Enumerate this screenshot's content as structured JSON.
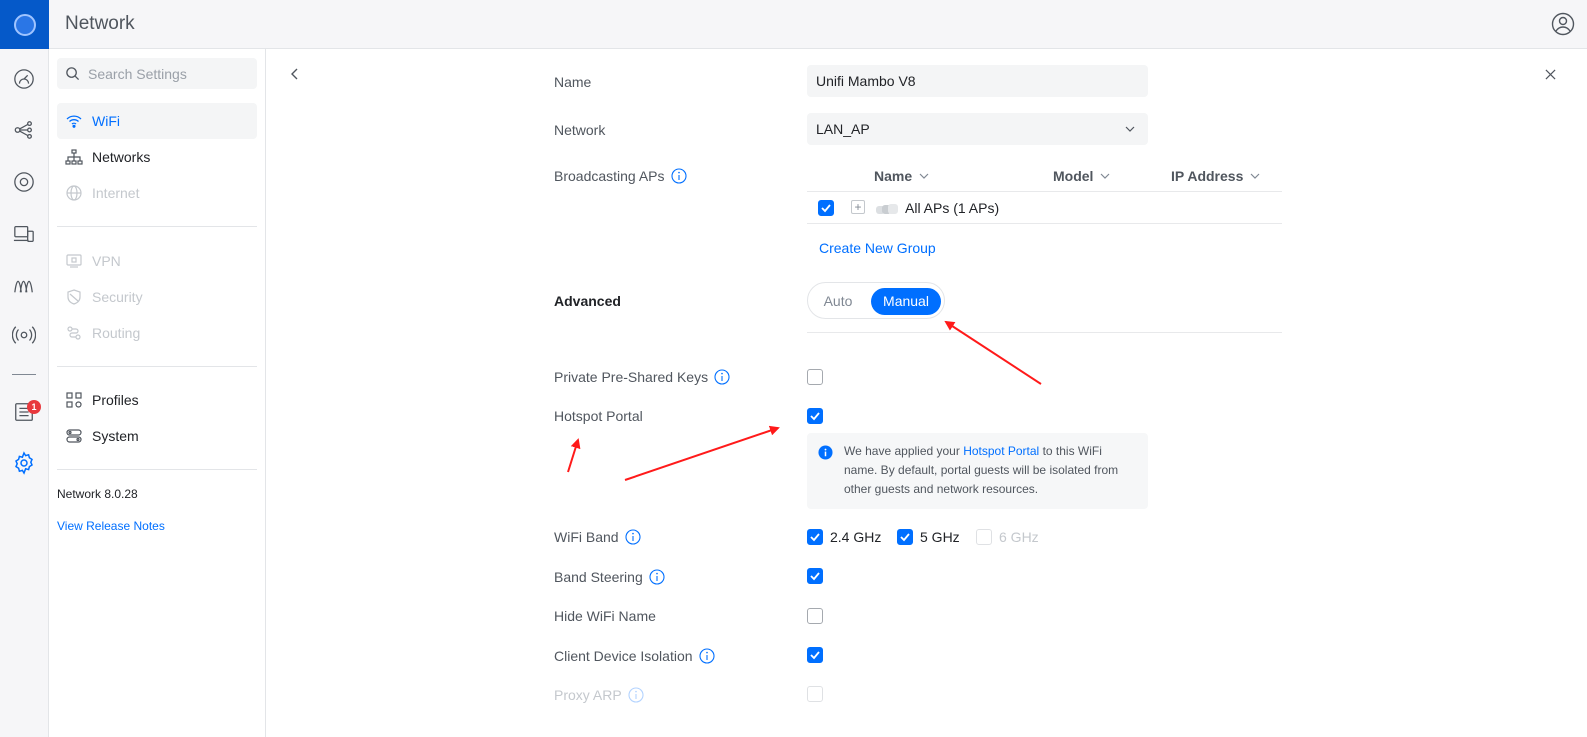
{
  "app": {
    "title": "Network"
  },
  "search": {
    "placeholder": "Search Settings"
  },
  "sidebar": {
    "items": [
      {
        "label": "WiFi",
        "state": "active",
        "icon": "wifi-icon"
      },
      {
        "label": "Networks",
        "state": "normal",
        "icon": "network-topology-icon"
      },
      {
        "label": "Internet",
        "state": "disabled",
        "icon": "globe-icon"
      },
      {
        "label": "VPN",
        "state": "disabled",
        "icon": "vpn-icon"
      },
      {
        "label": "Security",
        "state": "disabled",
        "icon": "shield-icon"
      },
      {
        "label": "Routing",
        "state": "disabled",
        "icon": "routing-icon"
      },
      {
        "label": "Profiles",
        "state": "normal",
        "icon": "profiles-icon"
      },
      {
        "label": "System",
        "state": "normal",
        "icon": "system-icon"
      }
    ],
    "version": "Network 8.0.28",
    "release_notes": "View Release Notes"
  },
  "rail": {
    "badge_count": "1"
  },
  "form": {
    "name_label": "Name",
    "name_value": "Unifi Mambo V8",
    "network_label": "Network",
    "network_value": "LAN_AP",
    "broadcasting_label": "Broadcasting APs",
    "table": {
      "columns": [
        "Name",
        "Model",
        "IP Address"
      ],
      "row_label": "All APs (1 APs)"
    },
    "create_group": "Create New Group",
    "advanced_label": "Advanced",
    "advanced_options": {
      "auto": "Auto",
      "manual": "Manual",
      "selected": "Manual"
    },
    "ppsk_label": "Private Pre-Shared Keys",
    "hotspot_label": "Hotspot Portal",
    "notice": {
      "prefix": "We have applied your ",
      "link": "Hotspot Portal",
      "suffix": " to this WiFi name. By default, portal guests will be isolated from other guests and network resources."
    },
    "wifi_band_label": "WiFi Band",
    "bands": [
      "2.4 GHz",
      "5 GHz",
      "6 GHz"
    ],
    "band_steering_label": "Band Steering",
    "hide_wifi_label": "Hide WiFi Name",
    "client_isolation_label": "Client Device Isolation",
    "proxy_arp_label": "Proxy ARP"
  },
  "colors": {
    "accent": "#006fff",
    "brand": "#0559c9",
    "annotation": "#ff1a1a",
    "badge": "#e8383d"
  }
}
